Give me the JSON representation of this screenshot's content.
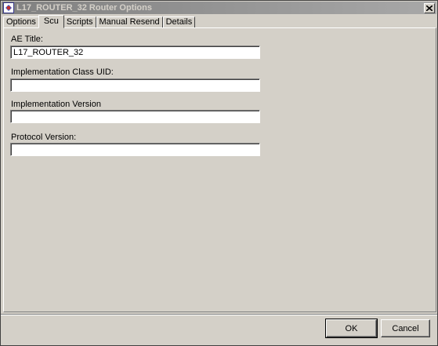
{
  "window": {
    "title": "L17_ROUTER_32 Router Options",
    "icon": "router-app-icon",
    "close_icon": "close-icon"
  },
  "tabs": [
    {
      "label": "Options",
      "active": false
    },
    {
      "label": "Scu",
      "active": true
    },
    {
      "label": "Scripts",
      "active": false
    },
    {
      "label": "Manual Resend",
      "active": false
    },
    {
      "label": "Details",
      "active": false
    }
  ],
  "form": {
    "ae_title": {
      "label": "AE Title:",
      "value": "L17_ROUTER_32"
    },
    "implementation_class_uid": {
      "label": "Implementation Class UID:",
      "value": ""
    },
    "implementation_version": {
      "label": "Implementation Version",
      "value": ""
    },
    "protocol_version": {
      "label": "Protocol Version:",
      "value": ""
    }
  },
  "buttons": {
    "ok": "OK",
    "cancel": "Cancel"
  }
}
